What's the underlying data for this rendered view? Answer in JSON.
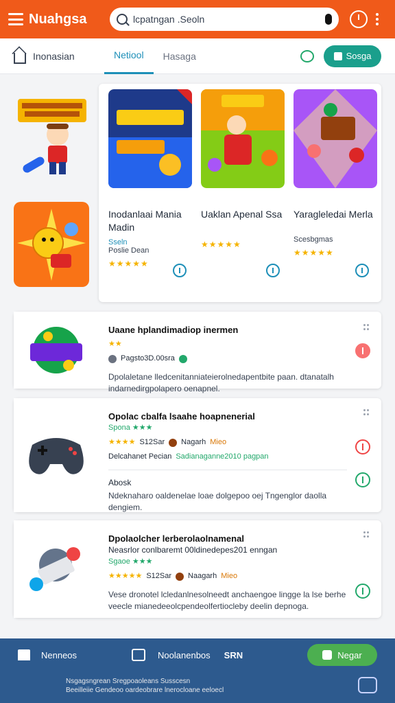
{
  "header": {
    "app_title": "Nuahgsa",
    "search_value": "lcpatngan .Seoln",
    "icons": [
      "menu-icon",
      "search-icon",
      "mic-icon",
      "clock-icon",
      "kebab-icon"
    ]
  },
  "tabs": {
    "items": [
      "Inonasian",
      "Netiool",
      "Hasaga"
    ],
    "active": "Netiool",
    "cta_label": "Sosga"
  },
  "featured": {
    "cards": [
      {
        "title": "Inodanlaai Mania Madin",
        "sub": "Sseln",
        "sub2": "Poslie Dean",
        "stars": "★★★★★"
      },
      {
        "title": "Uaklan Apenal Ssa",
        "sub": "",
        "sub2": "",
        "stars": "★★★★★"
      },
      {
        "title": "Yaragleledai Merla",
        "sub": "",
        "sub2": "Scesbgmas",
        "stars": "★★★★★"
      }
    ]
  },
  "list": [
    {
      "title": "Uaane hplandimadiop inermen",
      "meta": "Pagsto3D.00sra",
      "stars": "★★",
      "desc": "Dpolaletane lledcenitanniateierolnedapentbite paan. dtanatalh indarnedirgpolapero oenapnel."
    },
    {
      "title": "Opolac cbalfa lsaahe hoapnenerial",
      "label": "Spona ★★★",
      "stars": "★★★★",
      "meta": "S12Sar",
      "meta2": "Nagarh",
      "tag": "Mieo",
      "desc": "Delcahanet Pecian",
      "desc_link": "Sadianaganne2010 pagpan",
      "sub_title": "Abosk",
      "sub_desc": "Ndeknaharo oaldenelae loae dolgepoo oej Tngenglor daolla dengiem."
    },
    {
      "title": "Dpolaolcher lerberolaolnamenal",
      "subtitle": "Neasrlor conlbaremt 00ldinedepes201 enngan",
      "label": "Sgaoe ★★★",
      "stars": "★★★★★",
      "meta": "S12Sar",
      "meta2": "Naagarh",
      "tag": "Mieo",
      "desc": "Vese dronotel lcledanlnesolneedt anchaengoe lingge la lse berhe veecle mianedeeolcpendeolfertiocleby deelin depnoga."
    }
  ],
  "bottom_nav": {
    "home_label": "Nenneos",
    "mid_label": "Noolanenbos",
    "num_label": "SRN",
    "cta_label": "Negar",
    "footer_line1": "Nsgagsngrean Sregpoaoleans Susscesn",
    "footer_line2": "Beeilleiie Gendeoo oardeobrare lnerocloane eeloecl"
  },
  "colors": {
    "header": "#f05a1a",
    "accent": "#1d8fb8",
    "cta": "#1a9f8c",
    "bottom_nav": "#2d5a8e",
    "bottom_cta": "#4caf50",
    "stars": "#f5b301"
  }
}
